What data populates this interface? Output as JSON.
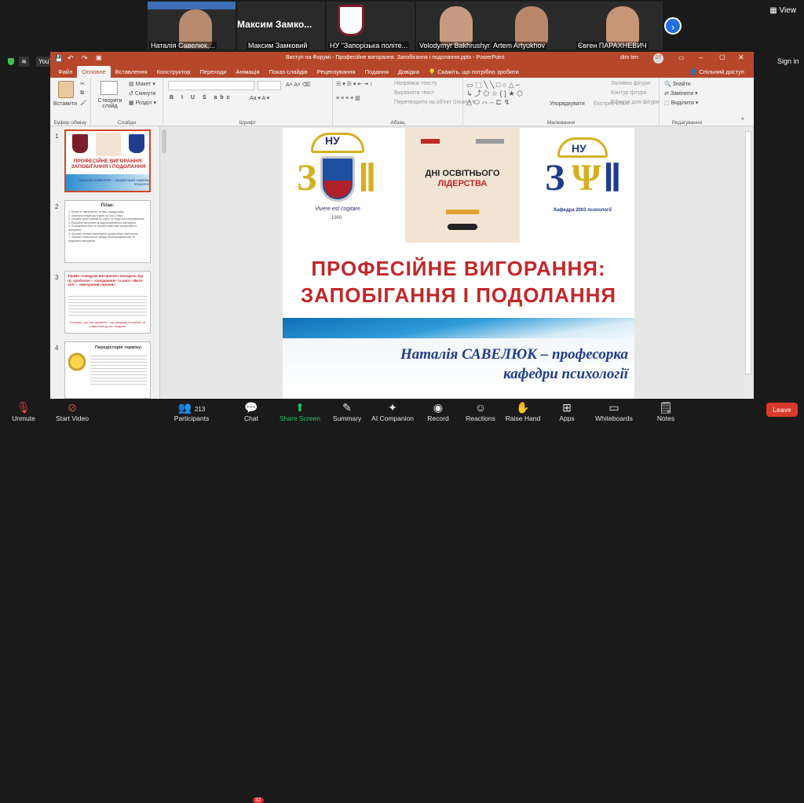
{
  "participants": [
    {
      "name": "Наталія Савелюк,...",
      "kind": "video"
    },
    {
      "name": "Максим Замковий",
      "kind": "text",
      "display": "Максим Замко..."
    },
    {
      "name": "НУ \"Запорізька політе...",
      "kind": "logo"
    },
    {
      "name": "Volodymyr Bakhrushyn",
      "kind": "video"
    },
    {
      "name": "Artem Artyukhov",
      "kind": "video"
    },
    {
      "name": "Євген ПАРАХНЕВИЧ",
      "kind": "video"
    }
  ],
  "top_controls": {
    "view_label": "View",
    "signin_label": "Sign in"
  },
  "browser": {
    "youtube_label": "YouTube"
  },
  "ppt": {
    "title": "Виступ на Форумі - Професійне вигорання. Запобігання і подолання.pptx - PowerPoint",
    "user": "dim ten",
    "user_initials": "DT",
    "tabs": [
      "Файл",
      "Основне",
      "Вставлення",
      "Конструктор",
      "Переходи",
      "Анімація",
      "Показ слайдів",
      "Рецензування",
      "Подання",
      "Довідка"
    ],
    "active_tab": "Основне",
    "tell_me": "Скажіть, що потрібно зробити",
    "share": "Спільний доступ",
    "ribbon": {
      "paste": "Вставити",
      "clipboard": "Буфер обміну",
      "new_slide": "Створити слайд",
      "layout": "Макет",
      "reset": "Скинути",
      "section": "Розділ",
      "slides": "Слайди",
      "font": "Шрифт",
      "text_direction": "Напрямок тексту",
      "align_text": "Вирівняти текст",
      "convert_smartart": "Перетворити на об'єкт SmartArt",
      "paragraph": "Абзац",
      "arrange": "Упорядкувати",
      "quick_styles": "Експрес-стилі",
      "fill": "Заливка фігури",
      "outline": "Контур фігури",
      "effects": "Ефекти для фігури",
      "drawing": "Малювання",
      "find": "Знайти",
      "replace": "Замінити",
      "select": "Виділити",
      "editing": "Редагування"
    },
    "thumbnails": [
      {
        "num": "1",
        "title": "ПРОФЕСІЙНЕ ВИГОРАННЯ: ЗАПОБІГАННЯ І ПОДОЛАННЯ",
        "subtitle": "Наталія САВЕЛЮК – професорка кафедри психології"
      },
      {
        "num": "2",
        "title": "План:",
        "lines": [
          "1. Поняття «вигорання» та його передісторія.",
          "2. Загальна концепція стресу за Ганс Сельє.",
          "3. Основні групи реакцій на стрес та стадії його переживання.",
          "4. Емоційне вигорання як вид професійного вигорання.",
          "5. Психодіагностика та основні симптоми професійного вигорання.",
          "6. Основні чинники виникнення професійного вигорання.",
          "7. Загальні психологічні засади психопрофілактики та подолання вигорання."
        ]
      },
      {
        "num": "3",
        "title": "Термін «синдром вигорання» походить від гр. syndrome – «поєднання» та англ. «Burn-out» – «вигорання горіння».",
        "footer": "Основне, що нас цікавить – це ситуація на роботі та ставлення до неї людини."
      },
      {
        "num": "4",
        "title": "Передісторія терміну:"
      }
    ],
    "slide": {
      "center_card_title": "ДНІ ОСВІТНЬОГО",
      "center_card_title2": "ЛІДЕРСТВА",
      "logo_left_top": "НУ",
      "logo_left_motto": "Vivere est cogitare",
      "logo_left_year": "1900",
      "logo_right_top": "НУ",
      "logo_right_caption": "Кафедра 2003 психології",
      "title_line1": "ПРОФЕСІЙНЕ ВИГОРАННЯ:",
      "title_line2": "ЗАПОБІГАННЯ І ПОДОЛАННЯ",
      "author_line1": "Наталія САВЕЛЮК – професорка",
      "author_line2": "кафедри психології"
    }
  },
  "bottom_bar": [
    {
      "label": "Unmute",
      "icon": "mic-muted-icon"
    },
    {
      "label": "Start Video",
      "icon": "video-off-icon"
    },
    {
      "label": "Participants",
      "icon": "participants-icon",
      "count": "213"
    },
    {
      "label": "Chat",
      "icon": "chat-icon",
      "badge": "32"
    },
    {
      "label": "Share Screen",
      "icon": "share-screen-icon"
    },
    {
      "label": "Summary",
      "icon": "summary-icon"
    },
    {
      "label": "AI Companion",
      "icon": "ai-companion-icon"
    },
    {
      "label": "Record",
      "icon": "record-icon"
    },
    {
      "label": "Reactions",
      "icon": "reactions-icon"
    },
    {
      "label": "Raise Hand",
      "icon": "raise-hand-icon"
    },
    {
      "label": "Apps",
      "icon": "apps-icon"
    },
    {
      "label": "Whiteboards",
      "icon": "whiteboards-icon"
    },
    {
      "label": "Notes",
      "icon": "notes-icon"
    }
  ],
  "leave_label": "Leave",
  "colors": {
    "ppt_red": "#b7472a",
    "slide_title_red": "#c0282a",
    "author_blue": "#1f3d8a",
    "share_green": "#22c55e",
    "leave_red": "#d93a2b"
  }
}
